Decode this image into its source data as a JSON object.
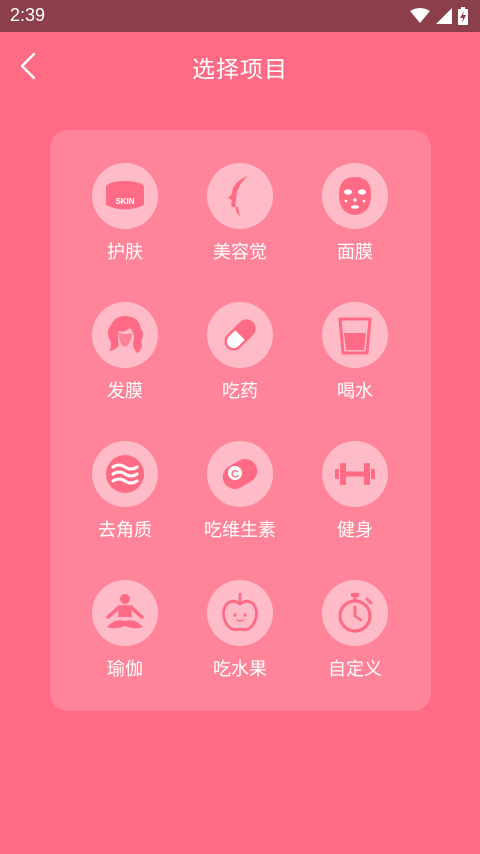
{
  "status": {
    "time": "2:39"
  },
  "header": {
    "title": "选择项目"
  },
  "items": [
    {
      "label": "护肤",
      "icon": "skin-cream-icon"
    },
    {
      "label": "美容觉",
      "icon": "sleep-face-icon"
    },
    {
      "label": "面膜",
      "icon": "face-mask-icon"
    },
    {
      "label": "发膜",
      "icon": "hair-icon"
    },
    {
      "label": "吃药",
      "icon": "pill-icon"
    },
    {
      "label": "喝水",
      "icon": "water-glass-icon"
    },
    {
      "label": "去角质",
      "icon": "exfoliate-icon"
    },
    {
      "label": "吃维生素",
      "icon": "vitamin-c-icon"
    },
    {
      "label": "健身",
      "icon": "dumbbell-icon"
    },
    {
      "label": "瑜伽",
      "icon": "yoga-icon"
    },
    {
      "label": "吃水果",
      "icon": "apple-icon"
    },
    {
      "label": "自定义",
      "icon": "stopwatch-icon"
    }
  ],
  "skin_text": "SKIN",
  "vitamin_text": "C",
  "colors": {
    "background": "#ff6b85",
    "statusbar": "#8a3f4b",
    "icon_glyph": "#ff6b85"
  }
}
